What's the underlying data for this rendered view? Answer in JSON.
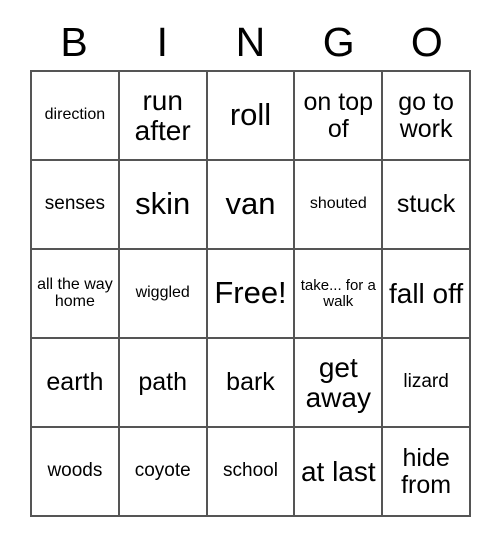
{
  "card": {
    "type": "bingo-card",
    "columns": 5,
    "rows": 5,
    "free_space": {
      "row": 3,
      "column": 3,
      "label": "Free!"
    },
    "header": {
      "letters": [
        "B",
        "I",
        "N",
        "G",
        "O"
      ]
    },
    "grid": [
      [
        {
          "text": "direction",
          "size": "xs"
        },
        {
          "text": "run after",
          "size": "lg"
        },
        {
          "text": "roll",
          "size": "xl"
        },
        {
          "text": "on top of",
          "size": "md"
        },
        {
          "text": "go to work",
          "size": "md"
        }
      ],
      [
        {
          "text": "senses",
          "size": "sm"
        },
        {
          "text": "skin",
          "size": "xl"
        },
        {
          "text": "van",
          "size": "xl"
        },
        {
          "text": "shouted",
          "size": "xs"
        },
        {
          "text": "stuck",
          "size": "md"
        }
      ],
      [
        {
          "text": "all the way home",
          "size": "xs"
        },
        {
          "text": "wiggled",
          "size": "xs"
        },
        {
          "text": "Free!",
          "size": "xl"
        },
        {
          "text": "take... for a walk",
          "size": "xxs"
        },
        {
          "text": "fall off",
          "size": "lg"
        }
      ],
      [
        {
          "text": "earth",
          "size": "md"
        },
        {
          "text": "path",
          "size": "md"
        },
        {
          "text": "bark",
          "size": "md"
        },
        {
          "text": "get away",
          "size": "lg"
        },
        {
          "text": "lizard",
          "size": "sm"
        }
      ],
      [
        {
          "text": "woods",
          "size": "sm"
        },
        {
          "text": "coyote",
          "size": "sm"
        },
        {
          "text": "school",
          "size": "sm"
        },
        {
          "text": "at last",
          "size": "lg"
        },
        {
          "text": "hide from",
          "size": "md"
        }
      ]
    ]
  },
  "colors": {
    "background": "#ffffff",
    "text": "#000000",
    "border": "#555555"
  }
}
